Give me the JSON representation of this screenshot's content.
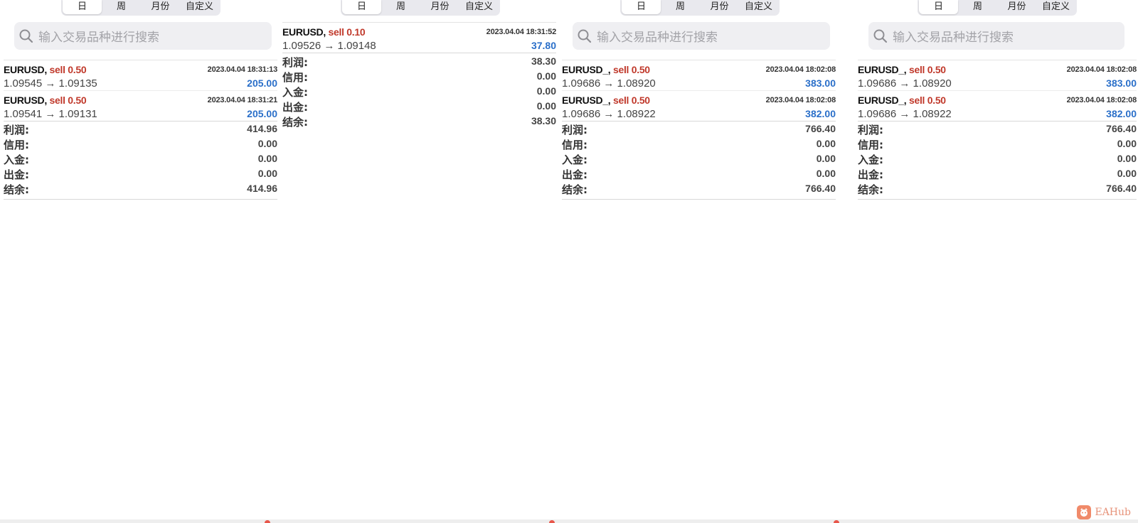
{
  "tabs": [
    "日",
    "周",
    "月份",
    "自定义"
  ],
  "search": {
    "placeholder": "输入交易品种进行搜索"
  },
  "summary_labels": [
    "利润:",
    "信用:",
    "入金:",
    "出金:",
    "结余:"
  ],
  "panels": [
    {
      "deals": [
        {
          "symbol": "EURUSD,",
          "side": "sell 0.50",
          "time": "2023.04.04 18:31:13",
          "prices": "1.09545 → 1.09135",
          "profit": "205.00"
        },
        {
          "symbol": "EURUSD,",
          "side": "sell 0.50",
          "time": "2023.04.04 18:31:21",
          "prices": "1.09541 → 1.09131",
          "profit": "205.00"
        }
      ],
      "summary": [
        "414.96",
        "0.00",
        "0.00",
        "0.00",
        "414.96"
      ]
    },
    {
      "deals": [
        {
          "symbol": "EURUSD,",
          "side": "sell 0.10",
          "time": "2023.04.04 18:31:52",
          "prices": "1.09526 → 1.09148",
          "profit": "37.80"
        }
      ],
      "summary": [
        "38.30",
        "0.00",
        "0.00",
        "0.00",
        "38.30"
      ]
    },
    {
      "deals": [
        {
          "symbol": "EURUSD_,",
          "side": "sell 0.50",
          "time": "2023.04.04 18:02:08",
          "prices": "1.09686 → 1.08920",
          "profit": "383.00"
        },
        {
          "symbol": "EURUSD_,",
          "side": "sell 0.50",
          "time": "2023.04.04 18:02:08",
          "prices": "1.09686 → 1.08922",
          "profit": "382.00"
        }
      ],
      "summary": [
        "766.40",
        "0.00",
        "0.00",
        "0.00",
        "766.40"
      ]
    },
    {
      "deals": [
        {
          "symbol": "EURUSD_,",
          "side": "sell 0.50",
          "time": "2023.04.04 18:02:08",
          "prices": "1.09686 → 1.08920",
          "profit": "383.00"
        },
        {
          "symbol": "EURUSD_,",
          "side": "sell 0.50",
          "time": "2023.04.04 18:02:08",
          "prices": "1.09686 → 1.08922",
          "profit": "382.00"
        }
      ],
      "summary": [
        "766.40",
        "0.00",
        "0.00",
        "0.00",
        "766.40"
      ]
    }
  ],
  "watermark": "EAHub",
  "colors": {
    "sell": "#c0392b",
    "profit": "#2a6fc9",
    "search_bg": "#efeff2"
  }
}
